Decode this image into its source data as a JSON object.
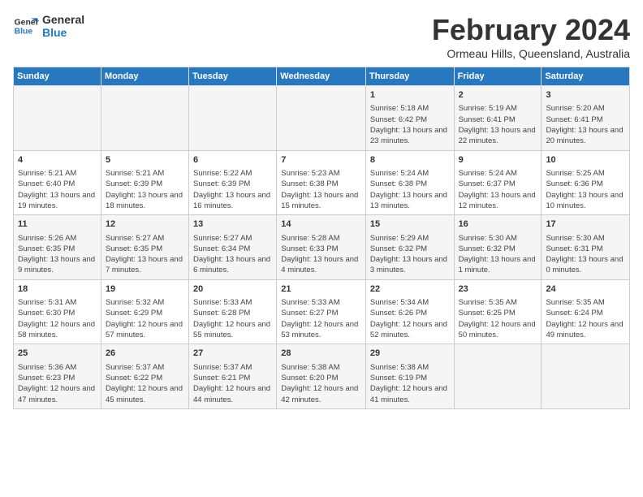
{
  "logo": {
    "line1": "General",
    "line2": "Blue"
  },
  "title": "February 2024",
  "subtitle": "Ormeau Hills, Queensland, Australia",
  "days_of_week": [
    "Sunday",
    "Monday",
    "Tuesday",
    "Wednesday",
    "Thursday",
    "Friday",
    "Saturday"
  ],
  "weeks": [
    [
      {
        "day": "",
        "info": ""
      },
      {
        "day": "",
        "info": ""
      },
      {
        "day": "",
        "info": ""
      },
      {
        "day": "",
        "info": ""
      },
      {
        "day": "1",
        "info": "Sunrise: 5:18 AM\nSunset: 6:42 PM\nDaylight: 13 hours and 23 minutes."
      },
      {
        "day": "2",
        "info": "Sunrise: 5:19 AM\nSunset: 6:41 PM\nDaylight: 13 hours and 22 minutes."
      },
      {
        "day": "3",
        "info": "Sunrise: 5:20 AM\nSunset: 6:41 PM\nDaylight: 13 hours and 20 minutes."
      }
    ],
    [
      {
        "day": "4",
        "info": "Sunrise: 5:21 AM\nSunset: 6:40 PM\nDaylight: 13 hours and 19 minutes."
      },
      {
        "day": "5",
        "info": "Sunrise: 5:21 AM\nSunset: 6:39 PM\nDaylight: 13 hours and 18 minutes."
      },
      {
        "day": "6",
        "info": "Sunrise: 5:22 AM\nSunset: 6:39 PM\nDaylight: 13 hours and 16 minutes."
      },
      {
        "day": "7",
        "info": "Sunrise: 5:23 AM\nSunset: 6:38 PM\nDaylight: 13 hours and 15 minutes."
      },
      {
        "day": "8",
        "info": "Sunrise: 5:24 AM\nSunset: 6:38 PM\nDaylight: 13 hours and 13 minutes."
      },
      {
        "day": "9",
        "info": "Sunrise: 5:24 AM\nSunset: 6:37 PM\nDaylight: 13 hours and 12 minutes."
      },
      {
        "day": "10",
        "info": "Sunrise: 5:25 AM\nSunset: 6:36 PM\nDaylight: 13 hours and 10 minutes."
      }
    ],
    [
      {
        "day": "11",
        "info": "Sunrise: 5:26 AM\nSunset: 6:35 PM\nDaylight: 13 hours and 9 minutes."
      },
      {
        "day": "12",
        "info": "Sunrise: 5:27 AM\nSunset: 6:35 PM\nDaylight: 13 hours and 7 minutes."
      },
      {
        "day": "13",
        "info": "Sunrise: 5:27 AM\nSunset: 6:34 PM\nDaylight: 13 hours and 6 minutes."
      },
      {
        "day": "14",
        "info": "Sunrise: 5:28 AM\nSunset: 6:33 PM\nDaylight: 13 hours and 4 minutes."
      },
      {
        "day": "15",
        "info": "Sunrise: 5:29 AM\nSunset: 6:32 PM\nDaylight: 13 hours and 3 minutes."
      },
      {
        "day": "16",
        "info": "Sunrise: 5:30 AM\nSunset: 6:32 PM\nDaylight: 13 hours and 1 minute."
      },
      {
        "day": "17",
        "info": "Sunrise: 5:30 AM\nSunset: 6:31 PM\nDaylight: 13 hours and 0 minutes."
      }
    ],
    [
      {
        "day": "18",
        "info": "Sunrise: 5:31 AM\nSunset: 6:30 PM\nDaylight: 12 hours and 58 minutes."
      },
      {
        "day": "19",
        "info": "Sunrise: 5:32 AM\nSunset: 6:29 PM\nDaylight: 12 hours and 57 minutes."
      },
      {
        "day": "20",
        "info": "Sunrise: 5:33 AM\nSunset: 6:28 PM\nDaylight: 12 hours and 55 minutes."
      },
      {
        "day": "21",
        "info": "Sunrise: 5:33 AM\nSunset: 6:27 PM\nDaylight: 12 hours and 53 minutes."
      },
      {
        "day": "22",
        "info": "Sunrise: 5:34 AM\nSunset: 6:26 PM\nDaylight: 12 hours and 52 minutes."
      },
      {
        "day": "23",
        "info": "Sunrise: 5:35 AM\nSunset: 6:25 PM\nDaylight: 12 hours and 50 minutes."
      },
      {
        "day": "24",
        "info": "Sunrise: 5:35 AM\nSunset: 6:24 PM\nDaylight: 12 hours and 49 minutes."
      }
    ],
    [
      {
        "day": "25",
        "info": "Sunrise: 5:36 AM\nSunset: 6:23 PM\nDaylight: 12 hours and 47 minutes."
      },
      {
        "day": "26",
        "info": "Sunrise: 5:37 AM\nSunset: 6:22 PM\nDaylight: 12 hours and 45 minutes."
      },
      {
        "day": "27",
        "info": "Sunrise: 5:37 AM\nSunset: 6:21 PM\nDaylight: 12 hours and 44 minutes."
      },
      {
        "day": "28",
        "info": "Sunrise: 5:38 AM\nSunset: 6:20 PM\nDaylight: 12 hours and 42 minutes."
      },
      {
        "day": "29",
        "info": "Sunrise: 5:38 AM\nSunset: 6:19 PM\nDaylight: 12 hours and 41 minutes."
      },
      {
        "day": "",
        "info": ""
      },
      {
        "day": "",
        "info": ""
      }
    ]
  ]
}
